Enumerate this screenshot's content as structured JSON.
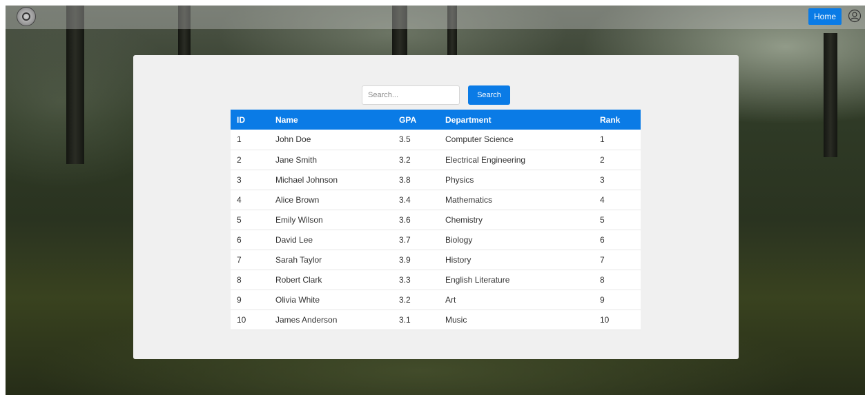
{
  "header": {
    "home_label": "Home",
    "logo_icon": "seal-logo",
    "user_icon": "user-circle-icon"
  },
  "search": {
    "placeholder": "Search...",
    "value": "",
    "button_label": "Search"
  },
  "table": {
    "columns": [
      "ID",
      "Name",
      "GPA",
      "Department",
      "Rank"
    ],
    "rows": [
      [
        "1",
        "John Doe",
        "3.5",
        "Computer Science",
        "1"
      ],
      [
        "2",
        "Jane Smith",
        "3.2",
        "Electrical Engineering",
        "2"
      ],
      [
        "3",
        "Michael Johnson",
        "3.8",
        "Physics",
        "3"
      ],
      [
        "4",
        "Alice Brown",
        "3.4",
        "Mathematics",
        "4"
      ],
      [
        "5",
        "Emily Wilson",
        "3.6",
        "Chemistry",
        "5"
      ],
      [
        "6",
        "David Lee",
        "3.7",
        "Biology",
        "6"
      ],
      [
        "7",
        "Sarah Taylor",
        "3.9",
        "History",
        "7"
      ],
      [
        "8",
        "Robert Clark",
        "3.3",
        "English Literature",
        "8"
      ],
      [
        "9",
        "Olivia White",
        "3.2",
        "Art",
        "9"
      ],
      [
        "10",
        "James Anderson",
        "3.1",
        "Music",
        "10"
      ]
    ]
  },
  "colors": {
    "accent": "#0a7be6",
    "panel_bg": "#f0f0f0"
  }
}
